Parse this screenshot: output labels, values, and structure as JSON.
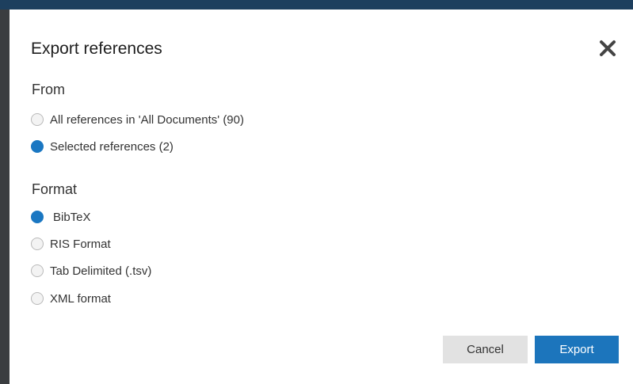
{
  "dialog": {
    "title": "Export references",
    "close_icon": "close-icon"
  },
  "from": {
    "heading": "From",
    "options": [
      {
        "label": "All references in 'All Documents' (90)",
        "selected": false
      },
      {
        "label": "Selected references (2)",
        "selected": true
      }
    ]
  },
  "format": {
    "heading": "Format",
    "options": [
      {
        "label": "BibTeX",
        "selected": true
      },
      {
        "label": "RIS Format",
        "selected": false
      },
      {
        "label": "Tab Delimited (.tsv)",
        "selected": false
      },
      {
        "label": "XML format",
        "selected": false
      }
    ]
  },
  "actions": {
    "cancel_label": "Cancel",
    "export_label": "Export"
  },
  "colors": {
    "accent": "#1c75bc",
    "cancel_bg": "#e2e2e2"
  }
}
